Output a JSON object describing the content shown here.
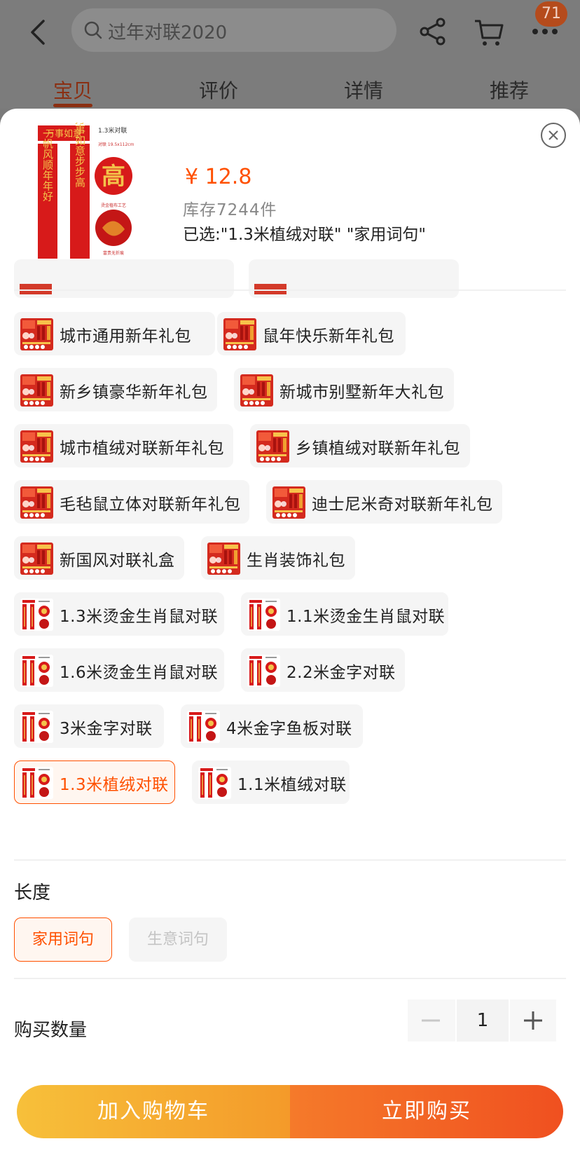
{
  "search": {
    "placeholder": "过年对联2020"
  },
  "header": {
    "cart_badge": "71"
  },
  "tabs": [
    {
      "label": "宝贝",
      "active": true
    },
    {
      "label": "评价",
      "active": false
    },
    {
      "label": "详情",
      "active": false
    },
    {
      "label": "推荐",
      "active": false
    }
  ],
  "product": {
    "price": "¥ 12.8",
    "stock": "库存7244件",
    "selected": "已选:\"1.3米植绒对联\" \"家用词句\"",
    "thumb_text": {
      "title": "1.3米对联",
      "size": "对联 19.5x112cm",
      "top_banner": "万事如意",
      "left_scroll": "一帆风顺年年好",
      "right_scroll": "万事如意步步高",
      "fu_char": "高",
      "caption1": "烫金植布工艺",
      "caption2": "富贵无折痕"
    }
  },
  "options": [
    {
      "label": "城市通用新年礼包",
      "type": "pack"
    },
    {
      "label": "鼠年快乐新年礼包",
      "type": "pack"
    },
    {
      "label": "新乡镇豪华新年礼包",
      "type": "pack"
    },
    {
      "label": "新城市别墅新年大礼包",
      "type": "pack"
    },
    {
      "label": "城市植绒对联新年礼包",
      "type": "pack"
    },
    {
      "label": "乡镇植绒对联新年礼包",
      "type": "pack"
    },
    {
      "label": "毛毡鼠立体对联新年礼包",
      "type": "pack"
    },
    {
      "label": "迪士尼米奇对联新年礼包",
      "type": "pack"
    },
    {
      "label": "新国风对联礼盒",
      "type": "pack"
    },
    {
      "label": "生肖装饰礼包",
      "type": "pack"
    },
    {
      "label": "1.3米烫金生肖鼠对联",
      "type": "couplet"
    },
    {
      "label": "1.1米烫金生肖鼠对联",
      "type": "couplet"
    },
    {
      "label": "1.6米烫金生肖鼠对联",
      "type": "couplet"
    },
    {
      "label": "2.2米金字对联",
      "type": "couplet"
    },
    {
      "label": "3米金字对联",
      "type": "couplet"
    },
    {
      "label": "4米金字鱼板对联",
      "type": "couplet"
    },
    {
      "label": "1.3米植绒对联",
      "type": "couplet",
      "selected": true
    },
    {
      "label": "1.1米植绒对联",
      "type": "couplet"
    }
  ],
  "length": {
    "title": "长度",
    "options": [
      {
        "label": "家用词句",
        "state": "selected"
      },
      {
        "label": "生意词句",
        "state": "disabled"
      }
    ]
  },
  "quantity": {
    "title": "购买数量",
    "value": "1"
  },
  "buttons": {
    "add_to_cart": "加入购物车",
    "buy_now": "立即购买"
  },
  "colors": {
    "accent": "#ff5000",
    "cart_start": "#f7c03a",
    "buy_end": "#f05020"
  }
}
